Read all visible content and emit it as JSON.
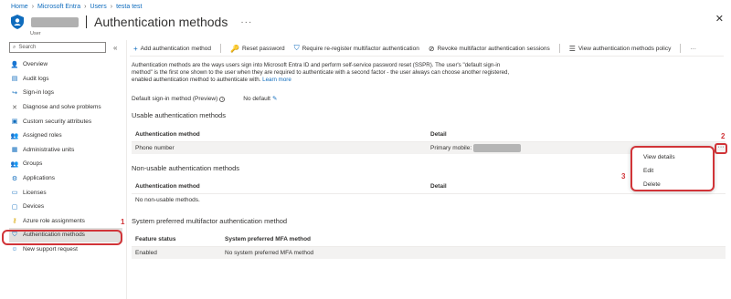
{
  "breadcrumb": [
    "Home",
    "Microsoft Entra",
    "Users",
    "testa test"
  ],
  "header": {
    "title": "Authentication methods",
    "subtitle": "User",
    "more": "···",
    "close": "✕"
  },
  "sidebar": {
    "search_placeholder": "Search",
    "collapse": "«",
    "items": [
      {
        "label": "Overview",
        "icon": "user-icon"
      },
      {
        "label": "Audit logs",
        "icon": "audit-logs-icon"
      },
      {
        "label": "Sign-in logs",
        "icon": "sign-in-logs-icon"
      },
      {
        "label": "Diagnose and solve problems",
        "icon": "wrench-icon"
      },
      {
        "label": "Custom security attributes",
        "icon": "attributes-icon"
      },
      {
        "label": "Assigned roles",
        "icon": "roles-icon"
      },
      {
        "label": "Administrative units",
        "icon": "admin-units-icon"
      },
      {
        "label": "Groups",
        "icon": "groups-icon"
      },
      {
        "label": "Applications",
        "icon": "applications-icon"
      },
      {
        "label": "Licenses",
        "icon": "licenses-icon"
      },
      {
        "label": "Devices",
        "icon": "devices-icon"
      },
      {
        "label": "Azure role assignments",
        "icon": "key-icon"
      },
      {
        "label": "Authentication methods",
        "icon": "shield-icon",
        "active": true
      },
      {
        "label": "New support request",
        "icon": "support-icon"
      }
    ]
  },
  "toolbar": {
    "add": "Add authentication method",
    "reset": "Reset password",
    "reregister": "Require re-register multifactor authentication",
    "revoke": "Revoke multifactor authentication sessions",
    "policy": "View authentication methods policy",
    "more": "···"
  },
  "description": {
    "text": "Authentication methods are the ways users sign into Microsoft Entra ID and perform self-service password reset (SSPR). The user's \"default sign-in method\" is the first one shown to the user when they are required to authenticate with a second factor - the user always can choose another registered, enabled authentication method to authenticate with.",
    "link": "Learn more"
  },
  "default_method": {
    "label": "Default sign-in method (Preview)",
    "value": "No default"
  },
  "usable": {
    "title": "Usable authentication methods",
    "headers": [
      "Authentication method",
      "Detail"
    ],
    "rows": [
      {
        "method": "Phone number",
        "detail": "Primary mobile:"
      }
    ]
  },
  "non_usable": {
    "title": "Non-usable authentication methods",
    "headers": [
      "Authentication method",
      "Detail"
    ],
    "empty": "No non-usable methods."
  },
  "preferred": {
    "title": "System preferred multifactor authentication method",
    "headers": [
      "Feature status",
      "System preferred MFA method"
    ],
    "rows": [
      {
        "status": "Enabled",
        "method": "No system preferred MFA method"
      }
    ]
  },
  "context_menu": [
    "View details",
    "Edit",
    "Delete"
  ],
  "annotations": [
    "1",
    "2",
    "3"
  ],
  "colors": {
    "accent": "#0f6cbd",
    "annotation": "#d13438"
  }
}
